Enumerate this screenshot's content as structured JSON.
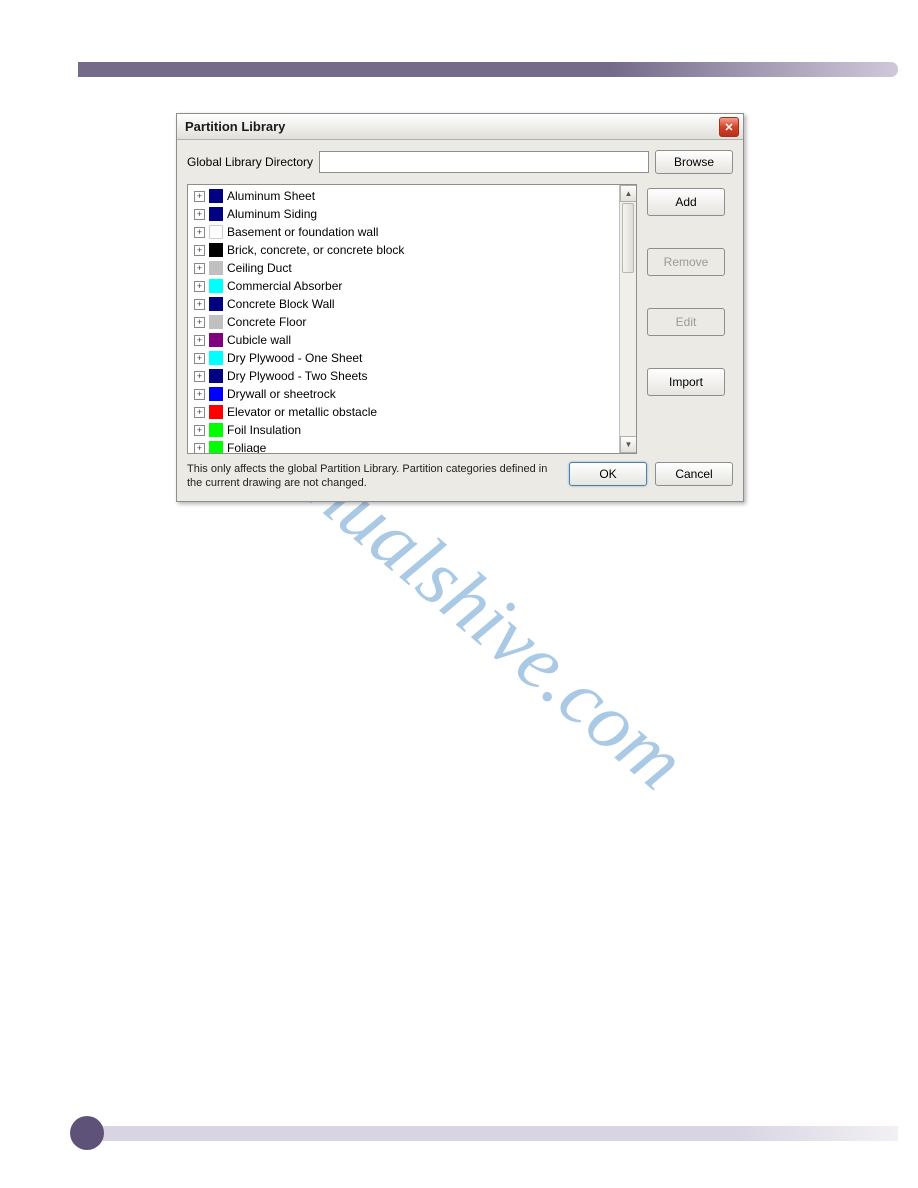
{
  "watermark": "manualshive.com",
  "dialog": {
    "title": "Partition Library",
    "directory_label": "Global Library Directory",
    "directory_value": "",
    "browse_label": "Browse",
    "buttons": {
      "add": "Add",
      "remove": "Remove",
      "edit": "Edit",
      "import": "Import",
      "ok": "OK",
      "cancel": "Cancel"
    },
    "footer_text": "This only affects the global Partition Library.  Partition categories defined in the current drawing are not changed.",
    "items": [
      {
        "label": "Aluminum Sheet",
        "color": "#000080"
      },
      {
        "label": "Aluminum Siding",
        "color": "#000080"
      },
      {
        "label": "Basement or foundation wall",
        "color": "#ffffff"
      },
      {
        "label": "Brick, concrete, or concrete block",
        "color": "#000000"
      },
      {
        "label": "Ceiling Duct",
        "color": "#c0c0c0"
      },
      {
        "label": "Commercial Absorber",
        "color": "#00ffff"
      },
      {
        "label": "Concrete Block Wall",
        "color": "#000080"
      },
      {
        "label": "Concrete Floor",
        "color": "#c0c0c0"
      },
      {
        "label": "Cubicle wall",
        "color": "#800080"
      },
      {
        "label": "Dry Plywood - One Sheet",
        "color": "#00ffff"
      },
      {
        "label": "Dry Plywood - Two Sheets",
        "color": "#000080"
      },
      {
        "label": "Drywall or sheetrock",
        "color": "#0000ff"
      },
      {
        "label": "Elevator or metallic obstacle",
        "color": "#ff0000"
      },
      {
        "label": "Foil Insulation",
        "color": "#00ff00"
      },
      {
        "label": "Foliage",
        "color": "#00ff00"
      }
    ]
  }
}
